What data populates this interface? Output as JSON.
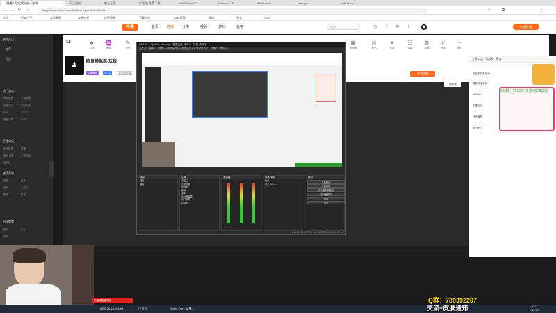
{
  "browser": {
    "active_tab": "【唯爱】欧皇模拟器-玩游戏",
    "tabs": [
      "天天美剧",
      "商业直播",
      "3D智能 免费下载",
      "OBS Studio 27",
      "Windows 10",
      "Dashboard",
      "Google",
      "Mod Shop"
    ],
    "url": "https://www.douyu.com/6384xxx?dyshid=1-d1cb4d...",
    "bookmarks": [
      "应用",
      "百度一下",
      "斗鱼直播",
      "哔哩哔哩",
      "虎牙直播",
      "下载中心",
      "OBS官网",
      "微博",
      "淘宝",
      "京东"
    ]
  },
  "site_header": {
    "logo": "斗鱼",
    "nav": [
      "首页",
      "直播",
      "分类",
      "视频",
      "游戏",
      "鱼吧"
    ],
    "search_placeholder": "搜索",
    "pc_app": "PC客户端"
  },
  "sidebar": {
    "sections": [
      {
        "title": "我的关注",
        "items": [
          "推荐",
          "分类"
        ]
      },
      {
        "title": "热门游戏",
        "items": [
          "英雄联盟",
          "王者荣耀",
          "绝地求生",
          "穿越火线",
          "DNF",
          "CSGO",
          "魔兽世界",
          "APEX"
        ]
      },
      {
        "title": "手游休闲",
        "items": [
          "和平精英",
          "原神",
          "第五人格",
          "火影忍者",
          "金铲铲"
        ]
      },
      {
        "title": "娱乐天地",
        "items": [
          "颜值",
          "户外",
          "音乐",
          "二次元",
          "舞蹈",
          "星秀"
        ]
      },
      {
        "title": "科技教育",
        "items": [
          "数码",
          "汽车",
          "教育"
        ]
      }
    ]
  },
  "room": {
    "viewer_count": "12",
    "title": "欧皇模拟器-玩我",
    "tags": [
      "主播等级",
      "LV.12",
      "欧皇模拟器"
    ],
    "toolbar_icons": [
      "礼物",
      "贵族",
      "粉丝团",
      "鱼丸",
      "分享",
      "举报",
      "弹幕",
      "设置",
      "签到",
      "更多"
    ],
    "follow_label": "关注主播",
    "video_button": "画中画"
  },
  "obs": {
    "title": "OBS 26.1.1 (64-bit, windows) - 配置文件: 未命名 - 场景: 未命名",
    "menu": [
      "文件(F)",
      "编辑(E)",
      "视图(V)",
      "停靠部件(D)",
      "配置文件(P)",
      "场景集合(S)",
      "工具(T)",
      "帮助(H)"
    ],
    "docks": {
      "scenes": {
        "title": "场景",
        "items": [
          "场景",
          "摄像"
        ]
      },
      "sources": {
        "title": "来源",
        "items": [
          "小窗口",
          "浏览器源",
          "摄像头",
          "图像",
          "文本",
          "显示器采集",
          "窗口采集",
          "媒体源"
        ]
      },
      "mixer": {
        "title": "混音器"
      },
      "transitions": {
        "title": "转场特效",
        "items": [
          "淡出",
          "时长 300 ms"
        ]
      },
      "controls": {
        "title": "控制",
        "items": [
          "开始推流",
          "开始录制",
          "启动虚拟摄像机",
          "工作室模式",
          "设置",
          "退出"
        ]
      }
    },
    "status": "LIVE: 00:00:00   REC: 00:00:00   CPU: 3.6%, 30.00 fps"
  },
  "chat": {
    "tabs": [
      "主播公告",
      "贡献榜",
      "贵宾"
    ],
    "messages": [
      "欢迎来到直播间",
      "感谢关注主播",
      "666666",
      "主播加油",
      "好厉害啊",
      "来了来了"
    ],
    "banner": "QQ群：789392 交流+皮肤通知"
  },
  "overlay": {
    "qq_line": "Q群：789392207",
    "notify_line": "交流+皮肤通知",
    "popup": "已播放直播内容"
  },
  "taskbar": {
    "tasks": [
      "OBS 26.1.1 (64-bit...",
      "YY语音",
      "Studio One - 录播..."
    ],
    "time": "20:11",
    "date": "2021/8/6"
  }
}
